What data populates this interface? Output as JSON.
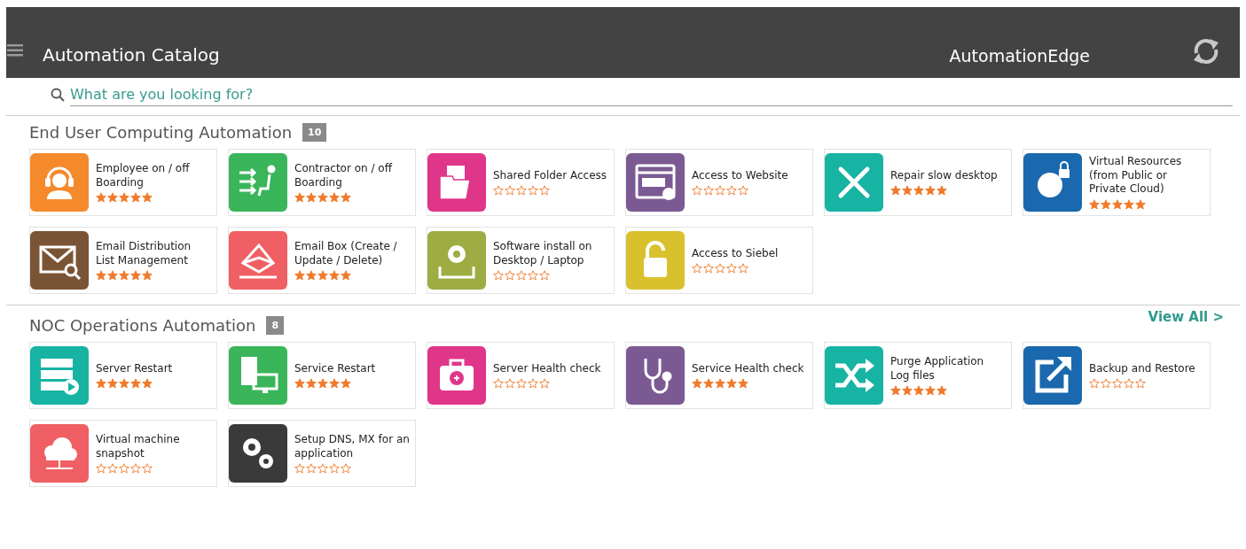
{
  "header": {
    "title": "Automation Catalog",
    "brand": "AutomationEdge"
  },
  "search": {
    "placeholder": "What are you looking for?"
  },
  "sections": [
    {
      "title": "End User Computing Automation",
      "count": "10",
      "items": [
        {
          "title": "Employee on / off Boarding",
          "stars": 5,
          "color": "#f58a2c"
        },
        {
          "title": "Contractor on / off Boarding",
          "stars": 5,
          "color": "#3ab55a"
        },
        {
          "title": "Shared Folder Access",
          "stars": 0,
          "color": "#e0368a"
        },
        {
          "title": "Access to Website",
          "stars": 0,
          "color": "#7b5a93"
        },
        {
          "title": "Repair slow desktop",
          "stars": 5,
          "color": "#17b3a3"
        },
        {
          "title": "Virtual Resources (from Public or Private Cloud)",
          "stars": 5,
          "color": "#1a68ad"
        },
        {
          "title": "Email Distribution List Management",
          "stars": 5,
          "color": "#7a5535"
        },
        {
          "title": "Email Box (Create / Update / Delete)",
          "stars": 5,
          "color": "#ef5f63"
        },
        {
          "title": "Software install on Desktop / Laptop",
          "stars": 0,
          "color": "#9eac44"
        },
        {
          "title": "Access to Siebel",
          "stars": 0,
          "color": "#d9c12e"
        }
      ]
    },
    {
      "title": "NOC Operations Automation",
      "count": "8",
      "link": "View All >",
      "items": [
        {
          "title": "Server Restart",
          "stars": 5,
          "color": "#17b3a3"
        },
        {
          "title": "Service Restart",
          "stars": 5,
          "color": "#3ab55a"
        },
        {
          "title": "Server Health check",
          "stars": 0,
          "color": "#e0368a"
        },
        {
          "title": "Service Health check",
          "stars": 5,
          "color": "#7b5a93"
        },
        {
          "title": "Purge Application Log files",
          "stars": 5,
          "color": "#17b3a3"
        },
        {
          "title": "Backup and Restore",
          "stars": 0,
          "color": "#1a68ad"
        },
        {
          "title": "Virtual machine snapshot",
          "stars": 0,
          "color": "#ef5f63"
        },
        {
          "title": "Setup DNS, MX for an application",
          "stars": 0,
          "color": "#3a3a3a"
        }
      ]
    }
  ]
}
